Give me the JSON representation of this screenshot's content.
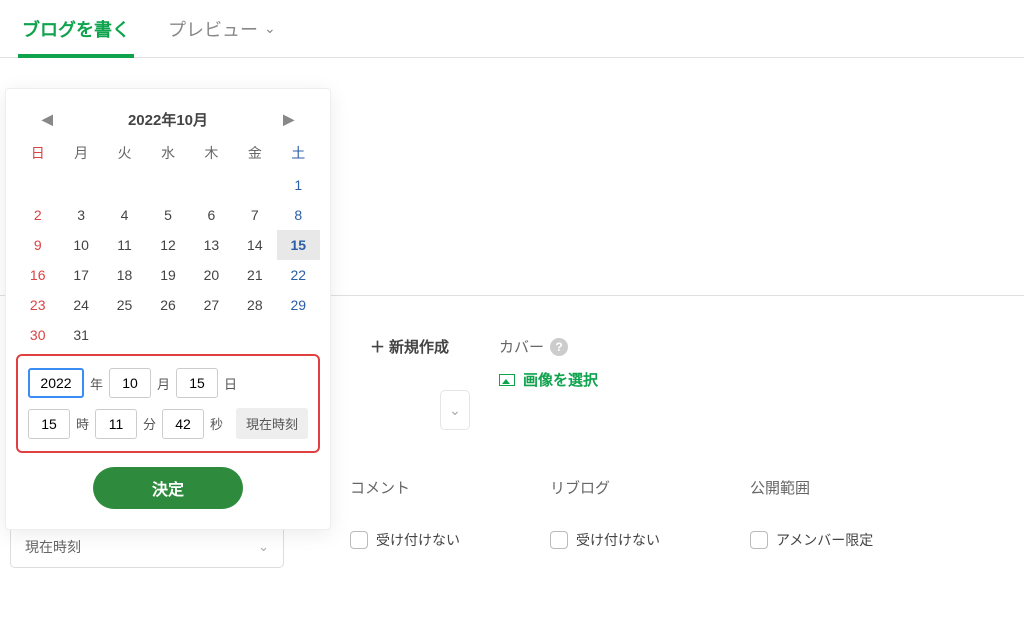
{
  "tabs": {
    "write": "ブログを書く",
    "preview": "プレビュー"
  },
  "cal": {
    "title": "2022年10月",
    "dow": {
      "sun": "日",
      "mon": "月",
      "tue": "火",
      "wed": "水",
      "thu": "木",
      "fri": "金",
      "sat": "土"
    },
    "rows": [
      [
        "",
        "",
        "",
        "",
        "",
        "",
        "1"
      ],
      [
        "2",
        "3",
        "4",
        "5",
        "6",
        "7",
        "8"
      ],
      [
        "9",
        "10",
        "11",
        "12",
        "13",
        "14",
        "15"
      ],
      [
        "16",
        "17",
        "18",
        "19",
        "20",
        "21",
        "22"
      ],
      [
        "23",
        "24",
        "25",
        "26",
        "27",
        "28",
        "29"
      ],
      [
        "30",
        "31",
        "",
        "",
        "",
        "",
        ""
      ]
    ]
  },
  "dt": {
    "year": "2022",
    "yl": "年",
    "month": "10",
    "ml": "月",
    "day": "15",
    "dl": "日",
    "hour": "15",
    "hl": "時",
    "min": "11",
    "il": "分",
    "sec": "42",
    "sl": "秒",
    "now": "現在時刻",
    "ok": "決定"
  },
  "sel": {
    "current_time": "現在時刻"
  },
  "form": {
    "new_create": "新規作成",
    "cover": "カバー",
    "select_image": "画像を選択",
    "comment": "コメント",
    "reblog": "リブログ",
    "scope": "公開範囲",
    "not_accept": "受け付けない",
    "amember": "アメンバー限定"
  }
}
